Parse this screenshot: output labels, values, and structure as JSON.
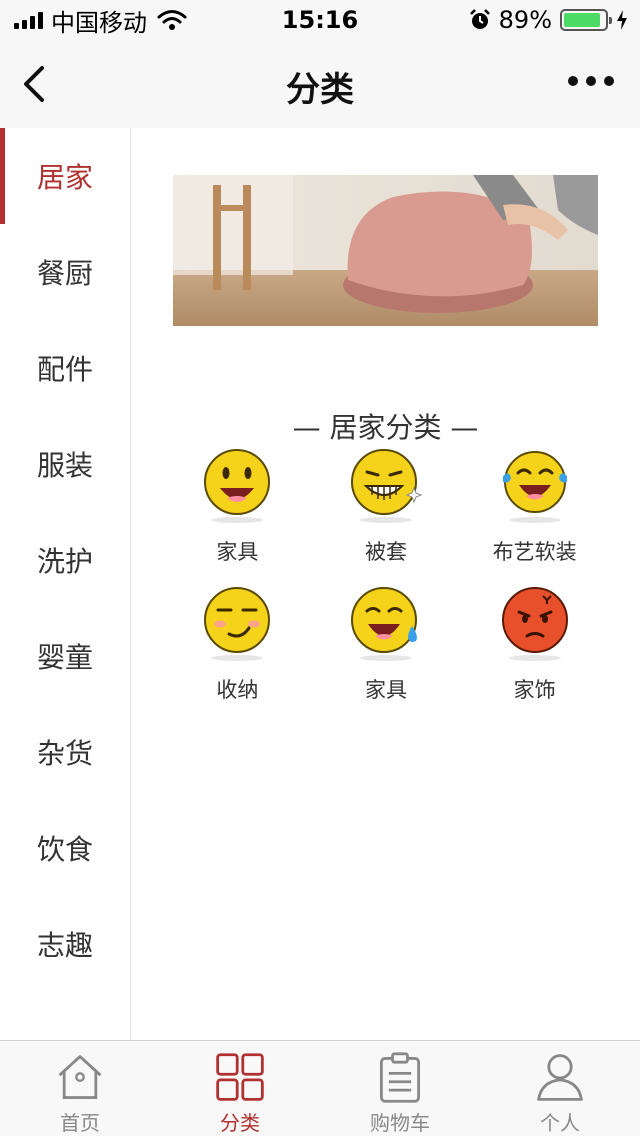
{
  "status_bar": {
    "carrier": "中国移动",
    "time": "15:16",
    "battery": "89%",
    "battery_level": 0.89
  },
  "nav": {
    "title": "分类"
  },
  "sidebar": {
    "items": [
      {
        "label": "居家"
      },
      {
        "label": "餐厨"
      },
      {
        "label": "配件"
      },
      {
        "label": "服装"
      },
      {
        "label": "洗护"
      },
      {
        "label": "婴童"
      },
      {
        "label": "杂货"
      },
      {
        "label": "饮食"
      },
      {
        "label": "志趣"
      }
    ],
    "active_index": 0
  },
  "section": {
    "title": "— 居家分类 —"
  },
  "categories": [
    {
      "label": "家具",
      "icon": "smile-open-emoji-icon"
    },
    {
      "label": "被套",
      "icon": "grin-sparkle-emoji-icon"
    },
    {
      "label": "布艺软装",
      "icon": "laugh-tears-emoji-icon"
    },
    {
      "label": "收纳",
      "icon": "smirk-emoji-icon"
    },
    {
      "label": "家具",
      "icon": "sweat-smile-emoji-icon"
    },
    {
      "label": "家饰",
      "icon": "angry-emoji-icon"
    }
  ],
  "tabbar": {
    "items": [
      {
        "label": "首页",
        "icon": "home-icon"
      },
      {
        "label": "分类",
        "icon": "grid-icon"
      },
      {
        "label": "购物车",
        "icon": "clipboard-icon"
      },
      {
        "label": "个人",
        "icon": "person-icon"
      }
    ],
    "active_index": 1
  },
  "colors": {
    "accent": "#b0312f",
    "emoji_yellow": "#f5d31a",
    "emoji_red": "#e8502c"
  }
}
